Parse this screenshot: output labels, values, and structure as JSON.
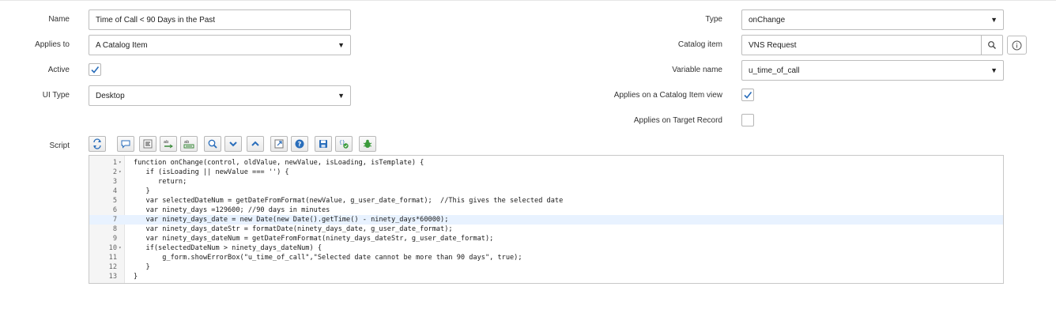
{
  "form": {
    "name": {
      "label": "Name",
      "value": "Time of Call < 90 Days in the Past"
    },
    "applies_to": {
      "label": "Applies to",
      "value": "A Catalog Item"
    },
    "active": {
      "label": "Active",
      "checked": true
    },
    "ui_type": {
      "label": "UI Type",
      "value": "Desktop"
    },
    "type": {
      "label": "Type",
      "value": "onChange"
    },
    "catalog_item": {
      "label": "Catalog item",
      "value": "VNS Request"
    },
    "variable_name": {
      "label": "Variable name",
      "value": "u_time_of_call"
    },
    "applies_on_catalog_item_view": {
      "label": "Applies on a Catalog Item view",
      "checked": true
    },
    "applies_on_target_record": {
      "label": "Applies on Target Record",
      "checked": false
    },
    "script": {
      "label": "Script"
    }
  },
  "toolbar": {
    "buttons": [
      "toggle-syntax-icon",
      "comment-icon",
      "format-icon",
      "replace-icon",
      "replace-all-icon",
      "search-icon",
      "search-down-icon",
      "search-up-icon",
      "fullscreen-icon",
      "help-icon",
      "save-icon",
      "check-syntax-icon",
      "debug-icon"
    ]
  },
  "script_lines": [
    {
      "n": "1",
      "fold": "▾",
      "code": "function onChange(control, oldValue, newValue, isLoading, isTemplate) {"
    },
    {
      "n": "2",
      "fold": "▾",
      "code": "   if (isLoading || newValue === '') {"
    },
    {
      "n": "3",
      "fold": "",
      "code": "      return;"
    },
    {
      "n": "4",
      "fold": "",
      "code": "   }"
    },
    {
      "n": "5",
      "fold": "",
      "code": "   var selectedDateNum = getDateFromFormat(newValue, g_user_date_format);  //This gives the selected date"
    },
    {
      "n": "6",
      "fold": "",
      "code": "   var ninety_days =129600; //90 days in minutes"
    },
    {
      "n": "7",
      "fold": "",
      "code": "   var ninety_days_date = new Date(new Date().getTime() - ninety_days*60000);"
    },
    {
      "n": "8",
      "fold": "",
      "code": "   var ninety_days_dateStr = formatDate(ninety_days_date, g_user_date_format);"
    },
    {
      "n": "9",
      "fold": "",
      "code": "   var ninety_days_dateNum = getDateFromFormat(ninety_days_dateStr, g_user_date_format);"
    },
    {
      "n": "10",
      "fold": "▾",
      "code": "   if(selectedDateNum > ninety_days_dateNum) {"
    },
    {
      "n": "11",
      "fold": "",
      "code": "       g_form.showErrorBox(\"u_time_of_call\",\"Selected date cannot be more than 90 days\", true);"
    },
    {
      "n": "12",
      "fold": "",
      "code": "   }"
    },
    {
      "n": "13",
      "fold": "",
      "code": "}"
    }
  ],
  "colors": {
    "check": "#2a6ebb",
    "active_line": "#e8f2ff"
  }
}
